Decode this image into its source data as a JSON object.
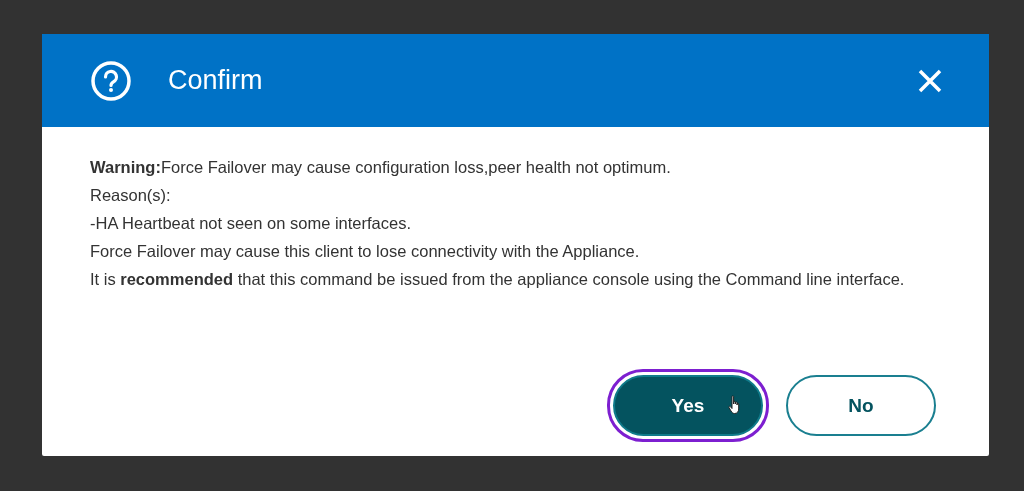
{
  "dialog": {
    "title": "Confirm",
    "message": [
      "**Warning:**Force Failover may cause configuration loss,peer health not optimum.",
      "Reason(s):",
      "-HA Heartbeat not seen on some interfaces.",
      "Force Failover may cause this client to lose connectivity with the Appliance.",
      "It is **recommended** that this command be issued from the appliance console using the Command line interface."
    ],
    "buttons": [
      {
        "label": "Yes",
        "kind": "primary",
        "focused": true
      },
      {
        "label": "No",
        "kind": "secondary",
        "focused": false
      }
    ]
  }
}
